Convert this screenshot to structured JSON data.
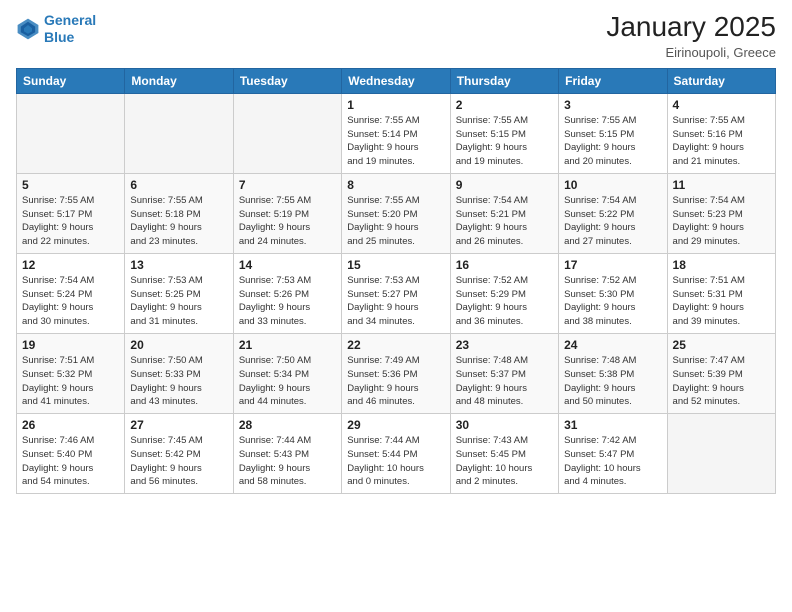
{
  "header": {
    "logo_line1": "General",
    "logo_line2": "Blue",
    "month": "January 2025",
    "location": "Eirinoupoli, Greece"
  },
  "weekdays": [
    "Sunday",
    "Monday",
    "Tuesday",
    "Wednesday",
    "Thursday",
    "Friday",
    "Saturday"
  ],
  "weeks": [
    [
      {
        "day": "",
        "info": ""
      },
      {
        "day": "",
        "info": ""
      },
      {
        "day": "",
        "info": ""
      },
      {
        "day": "1",
        "info": "Sunrise: 7:55 AM\nSunset: 5:14 PM\nDaylight: 9 hours\nand 19 minutes."
      },
      {
        "day": "2",
        "info": "Sunrise: 7:55 AM\nSunset: 5:15 PM\nDaylight: 9 hours\nand 19 minutes."
      },
      {
        "day": "3",
        "info": "Sunrise: 7:55 AM\nSunset: 5:15 PM\nDaylight: 9 hours\nand 20 minutes."
      },
      {
        "day": "4",
        "info": "Sunrise: 7:55 AM\nSunset: 5:16 PM\nDaylight: 9 hours\nand 21 minutes."
      }
    ],
    [
      {
        "day": "5",
        "info": "Sunrise: 7:55 AM\nSunset: 5:17 PM\nDaylight: 9 hours\nand 22 minutes."
      },
      {
        "day": "6",
        "info": "Sunrise: 7:55 AM\nSunset: 5:18 PM\nDaylight: 9 hours\nand 23 minutes."
      },
      {
        "day": "7",
        "info": "Sunrise: 7:55 AM\nSunset: 5:19 PM\nDaylight: 9 hours\nand 24 minutes."
      },
      {
        "day": "8",
        "info": "Sunrise: 7:55 AM\nSunset: 5:20 PM\nDaylight: 9 hours\nand 25 minutes."
      },
      {
        "day": "9",
        "info": "Sunrise: 7:54 AM\nSunset: 5:21 PM\nDaylight: 9 hours\nand 26 minutes."
      },
      {
        "day": "10",
        "info": "Sunrise: 7:54 AM\nSunset: 5:22 PM\nDaylight: 9 hours\nand 27 minutes."
      },
      {
        "day": "11",
        "info": "Sunrise: 7:54 AM\nSunset: 5:23 PM\nDaylight: 9 hours\nand 29 minutes."
      }
    ],
    [
      {
        "day": "12",
        "info": "Sunrise: 7:54 AM\nSunset: 5:24 PM\nDaylight: 9 hours\nand 30 minutes."
      },
      {
        "day": "13",
        "info": "Sunrise: 7:53 AM\nSunset: 5:25 PM\nDaylight: 9 hours\nand 31 minutes."
      },
      {
        "day": "14",
        "info": "Sunrise: 7:53 AM\nSunset: 5:26 PM\nDaylight: 9 hours\nand 33 minutes."
      },
      {
        "day": "15",
        "info": "Sunrise: 7:53 AM\nSunset: 5:27 PM\nDaylight: 9 hours\nand 34 minutes."
      },
      {
        "day": "16",
        "info": "Sunrise: 7:52 AM\nSunset: 5:29 PM\nDaylight: 9 hours\nand 36 minutes."
      },
      {
        "day": "17",
        "info": "Sunrise: 7:52 AM\nSunset: 5:30 PM\nDaylight: 9 hours\nand 38 minutes."
      },
      {
        "day": "18",
        "info": "Sunrise: 7:51 AM\nSunset: 5:31 PM\nDaylight: 9 hours\nand 39 minutes."
      }
    ],
    [
      {
        "day": "19",
        "info": "Sunrise: 7:51 AM\nSunset: 5:32 PM\nDaylight: 9 hours\nand 41 minutes."
      },
      {
        "day": "20",
        "info": "Sunrise: 7:50 AM\nSunset: 5:33 PM\nDaylight: 9 hours\nand 43 minutes."
      },
      {
        "day": "21",
        "info": "Sunrise: 7:50 AM\nSunset: 5:34 PM\nDaylight: 9 hours\nand 44 minutes."
      },
      {
        "day": "22",
        "info": "Sunrise: 7:49 AM\nSunset: 5:36 PM\nDaylight: 9 hours\nand 46 minutes."
      },
      {
        "day": "23",
        "info": "Sunrise: 7:48 AM\nSunset: 5:37 PM\nDaylight: 9 hours\nand 48 minutes."
      },
      {
        "day": "24",
        "info": "Sunrise: 7:48 AM\nSunset: 5:38 PM\nDaylight: 9 hours\nand 50 minutes."
      },
      {
        "day": "25",
        "info": "Sunrise: 7:47 AM\nSunset: 5:39 PM\nDaylight: 9 hours\nand 52 minutes."
      }
    ],
    [
      {
        "day": "26",
        "info": "Sunrise: 7:46 AM\nSunset: 5:40 PM\nDaylight: 9 hours\nand 54 minutes."
      },
      {
        "day": "27",
        "info": "Sunrise: 7:45 AM\nSunset: 5:42 PM\nDaylight: 9 hours\nand 56 minutes."
      },
      {
        "day": "28",
        "info": "Sunrise: 7:44 AM\nSunset: 5:43 PM\nDaylight: 9 hours\nand 58 minutes."
      },
      {
        "day": "29",
        "info": "Sunrise: 7:44 AM\nSunset: 5:44 PM\nDaylight: 10 hours\nand 0 minutes."
      },
      {
        "day": "30",
        "info": "Sunrise: 7:43 AM\nSunset: 5:45 PM\nDaylight: 10 hours\nand 2 minutes."
      },
      {
        "day": "31",
        "info": "Sunrise: 7:42 AM\nSunset: 5:47 PM\nDaylight: 10 hours\nand 4 minutes."
      },
      {
        "day": "",
        "info": ""
      }
    ]
  ]
}
